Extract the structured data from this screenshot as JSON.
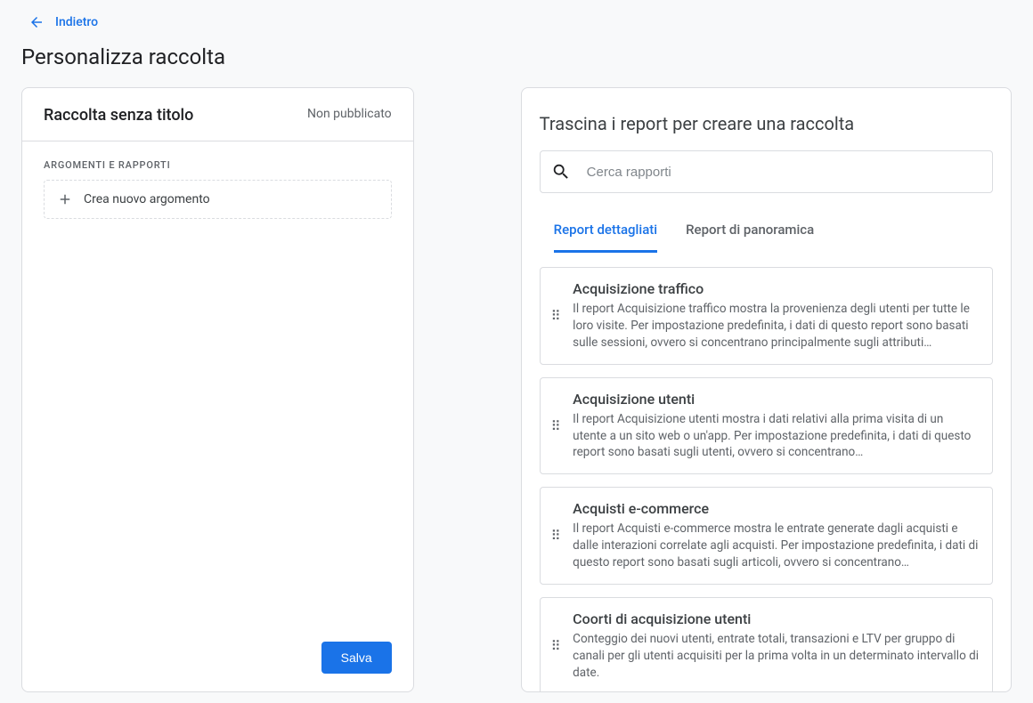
{
  "back_label": "Indietro",
  "page_title": "Personalizza raccolta",
  "left": {
    "title": "Raccolta senza titolo",
    "status": "Non pubblicato",
    "section_label": "ARGOMENTI E RAPPORTI",
    "create_topic": "Crea nuovo argomento",
    "save": "Salva"
  },
  "right": {
    "title": "Trascina i report per creare una raccolta",
    "search_placeholder": "Cerca rapporti",
    "tabs": {
      "detailed": "Report dettagliati",
      "overview": "Report di panoramica"
    },
    "reports": [
      {
        "title": "Acquisizione traffico",
        "desc": "Il report Acquisizione traffico mostra la provenienza degli utenti per tutte le loro visite. Per impostazione predefinita, i dati di questo report sono basati sulle sessioni, ovvero si concentrano principalmente sugli attributi…"
      },
      {
        "title": "Acquisizione utenti",
        "desc": "Il report Acquisizione utenti mostra i dati relativi alla prima visita di un utente a un sito web o un'app. Per impostazione predefinita, i dati di questo report sono basati sugli utenti, ovvero si concentrano…"
      },
      {
        "title": "Acquisti e-commerce",
        "desc": "Il report Acquisti e-commerce mostra le entrate generate dagli acquisti e dalle interazioni correlate agli acquisti. Per impostazione predefinita, i dati di questo report sono basati sugli articoli, ovvero si concentrano…"
      },
      {
        "title": "Coorti di acquisizione utenti",
        "desc": "Conteggio dei nuovi utenti, entrate totali, transazioni e LTV per gruppo di canali per gli utenti acquisiti per la prima volta in un determinato intervallo di date."
      }
    ]
  }
}
